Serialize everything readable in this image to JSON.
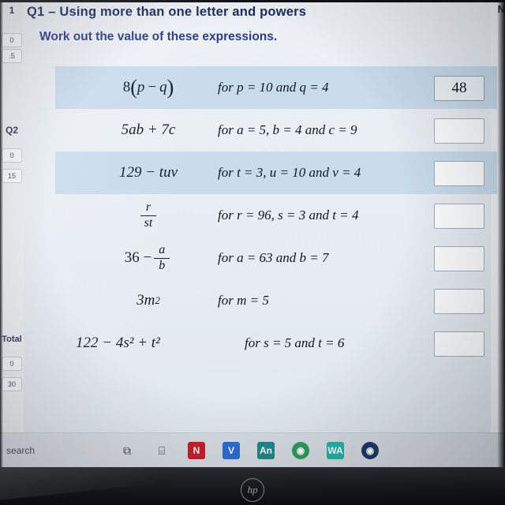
{
  "worksheet": {
    "question_number": "Q1",
    "question_dash": "–",
    "question_title": "Using more than one letter and powers",
    "instruction": "Work out the value of these expressions.",
    "top_right_label": "N"
  },
  "left_rail": {
    "items": [
      {
        "label": "1",
        "type": "bold"
      },
      {
        "label": "0",
        "type": "chip"
      },
      {
        "label": ".5",
        "type": "chip"
      },
      {
        "label": "Q2",
        "type": "bold"
      },
      {
        "label": "0",
        "type": "chip"
      },
      {
        "label": "15",
        "type": "chip"
      },
      {
        "label": "Total",
        "type": "bold"
      },
      {
        "label": "0",
        "type": "chip"
      },
      {
        "label": "30",
        "type": "chip"
      }
    ]
  },
  "rows": [
    {
      "expression_parts": {
        "coefficient": "8",
        "open": "(",
        "a": "p",
        "op": "−",
        "b": "q",
        "close": ")"
      },
      "expression_plain": "8(p − q)",
      "condition": "for p = 10 and q = 4",
      "answer": "48",
      "answer_filled": true,
      "shaded": true
    },
    {
      "expression_plain": "5ab + 7c",
      "condition": "for a = 5, b = 4 and c = 9",
      "answer": "",
      "answer_filled": false,
      "shaded": false
    },
    {
      "expression_plain": "129 − tuv",
      "condition": "for t = 3, u = 10 and v = 4",
      "answer": "",
      "answer_filled": false,
      "shaded": true
    },
    {
      "expression_plain": "r / st",
      "fraction": {
        "numerator": "r",
        "denominator": "st"
      },
      "condition": "for r = 96, s = 3 and t = 4",
      "answer": "",
      "answer_filled": false,
      "shaded": false
    },
    {
      "expression_plain": "36 − a/b",
      "lead": "36 −",
      "fraction": {
        "numerator": "a",
        "denominator": "b"
      },
      "condition": "for a = 63 and b = 7",
      "answer": "",
      "answer_filled": false,
      "shaded": false
    },
    {
      "expression_plain": "3m²",
      "base": "3m",
      "power": "2",
      "condition": "for m = 5",
      "answer": "",
      "answer_filled": false,
      "shaded": false
    },
    {
      "expression_plain": "122 − 4s² + t²",
      "condition": "for s = 5 and t = 6",
      "answer": "",
      "answer_filled": false,
      "shaded": false,
      "wide": true
    }
  ],
  "taskbar": {
    "search_placeholder": "search",
    "icons": [
      {
        "name": "task-view-icon",
        "glyph": "⧉",
        "style": "plain"
      },
      {
        "name": "windows-apps-icon",
        "glyph": "⌸",
        "style": "plain"
      },
      {
        "name": "netflix-icon",
        "glyph": "N",
        "style": "red"
      },
      {
        "name": "video-icon",
        "glyph": "V",
        "style": "blue"
      },
      {
        "name": "anaconda-icon",
        "glyph": "An",
        "style": "teal"
      },
      {
        "name": "chrome-icon",
        "glyph": "◉",
        "style": "green"
      },
      {
        "name": "whatsapp-icon",
        "glyph": "WA",
        "style": "mint"
      },
      {
        "name": "edge-icon",
        "glyph": "◉",
        "style": "dark"
      }
    ]
  },
  "laptop": {
    "brand": "hp"
  }
}
